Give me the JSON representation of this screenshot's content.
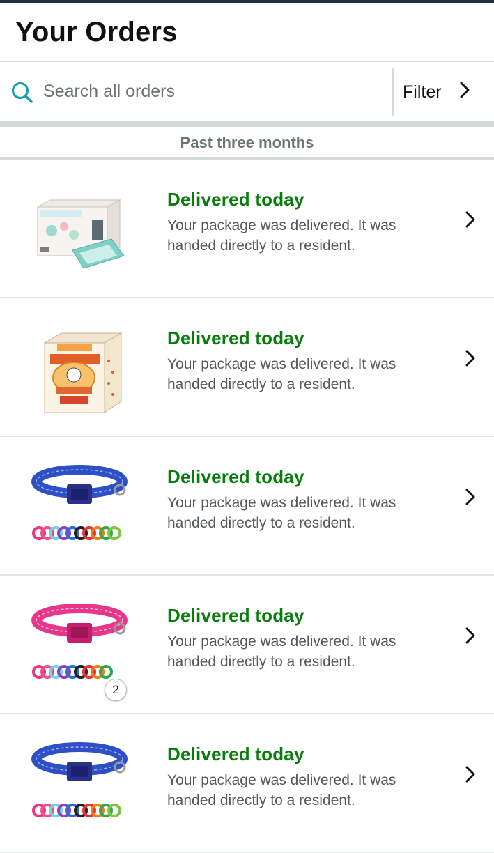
{
  "header": {
    "title": "Your Orders"
  },
  "search": {
    "placeholder": "Search all orders",
    "value": "",
    "icon": "search-icon"
  },
  "filter": {
    "label": "Filter",
    "icon": "chevron-right-icon"
  },
  "section": {
    "label": "Past three months"
  },
  "colors": {
    "accent": "#1a9fae",
    "status_green": "#067d0a",
    "divider": "#d5d9d9",
    "text_secondary": "#565959"
  },
  "orders": [
    {
      "status": "Delivered today",
      "detail": "Your package was delivered. It was handed directly to a resident.",
      "product_image": "baby-wipes-box"
    },
    {
      "status": "Delivered today",
      "detail": "Your package was delivered. It was handed directly to a resident.",
      "product_image": "pet-pads-box"
    },
    {
      "status": "Delivered today",
      "detail": "Your package was delivered. It was handed directly to a resident.",
      "product_image": "blue-dog-collar"
    },
    {
      "status": "Delivered today",
      "detail": "Your package was delivered. It was handed directly to a resident.",
      "product_image": "pink-dog-collar",
      "quantity": "2"
    },
    {
      "status": "Delivered today",
      "detail": "Your package was delivered. It was handed directly to a resident.",
      "product_image": "blue-dog-collar"
    }
  ]
}
